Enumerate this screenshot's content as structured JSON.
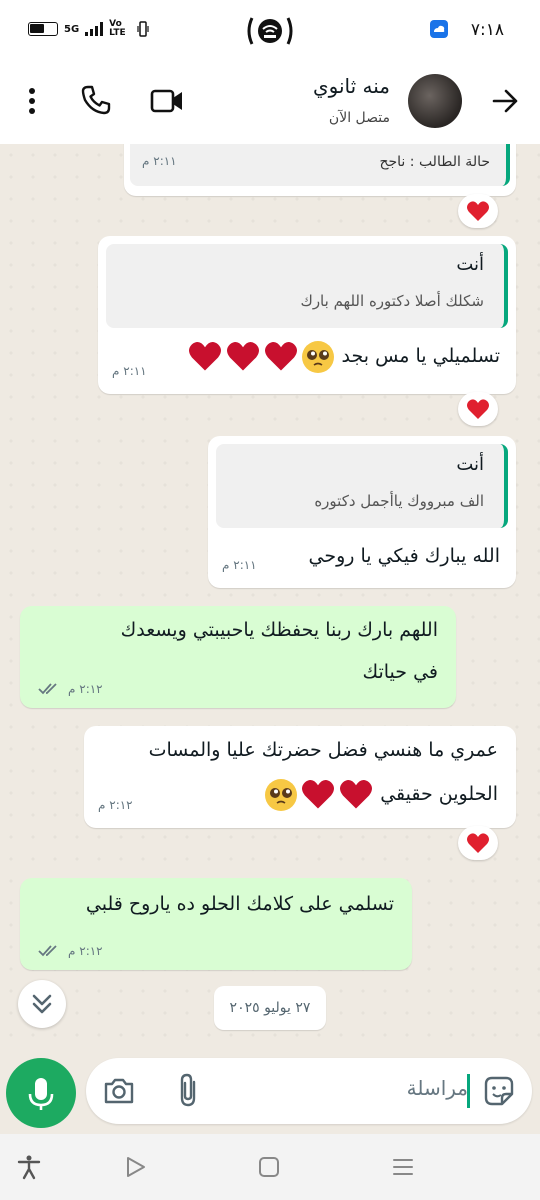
{
  "status_bar": {
    "time": "٧:١٨",
    "network": "5G",
    "volte": "Vo LTE",
    "icons": [
      "battery-icon",
      "signal-icon",
      "hotspot-icon",
      "cloud-app-icon"
    ]
  },
  "header": {
    "contact_name": "منه ثانوي",
    "contact_status": "متصل الآن",
    "icons": [
      "back-arrow-icon",
      "video-call-icon",
      "phone-icon",
      "more-vert-icon"
    ]
  },
  "messages": [
    {
      "id": "m1",
      "direction": "incoming",
      "quoted": {
        "text": "حالة الطالب : ناجح"
      },
      "time": "٢:١١ م",
      "reaction": "red-heart"
    },
    {
      "id": "m2",
      "direction": "incoming",
      "quoted": {
        "author": "أنت",
        "text": "شكلك أصلا دكتوره اللهم بارك"
      },
      "text": "تسلميلي يا مس بجد",
      "emoji": [
        "pleading-face",
        "red-heart",
        "red-heart",
        "red-heart"
      ],
      "time": "٢:١١ م",
      "reaction": "red-heart"
    },
    {
      "id": "m3",
      "direction": "incoming",
      "quoted": {
        "author": "أنت",
        "text": "الف مبرووك ياأجمل دكتوره"
      },
      "text": "الله يبارك فيكي يا روحي",
      "time": "٢:١١ م"
    },
    {
      "id": "m4",
      "direction": "outgoing",
      "text_line1": "اللهم بارك ربنا يحفظك ياحبيبتي ويسعدك",
      "text_line2": "في حياتك",
      "time": "٢:١٢ م",
      "read": true
    },
    {
      "id": "m5",
      "direction": "incoming",
      "text_line1": "عمري ما هنسي فضل حضرتك عليا والمسات",
      "text_line2": "الحلوين حقيقي",
      "emoji": [
        "red-heart",
        "red-heart",
        "pleading-face"
      ],
      "time": "٢:١٢ م",
      "reaction": "red-heart"
    },
    {
      "id": "m6",
      "direction": "outgoing",
      "text": "تسلمي على كلامك الحلو ده ياروح قلبي",
      "time": "٢:١٢ م",
      "read": true
    }
  ],
  "date_separator": "٢٧ يوليو ٢٠٢٥",
  "composer": {
    "placeholder": "مراسلة",
    "icons": [
      "sticker-icon",
      "attach-icon",
      "camera-icon",
      "mic-icon"
    ]
  },
  "colors": {
    "accent": "#1daa61",
    "outgoing_bubble": "#d9fdd3",
    "incoming_bubble": "#ffffff",
    "quote_bar": "#06a77d",
    "chat_background": "#efeae2",
    "heart": "#e0202f"
  },
  "navbar": {
    "icons": [
      "accessibility-icon",
      "back-triangle-icon",
      "home-square-icon",
      "recents-icon"
    ]
  }
}
